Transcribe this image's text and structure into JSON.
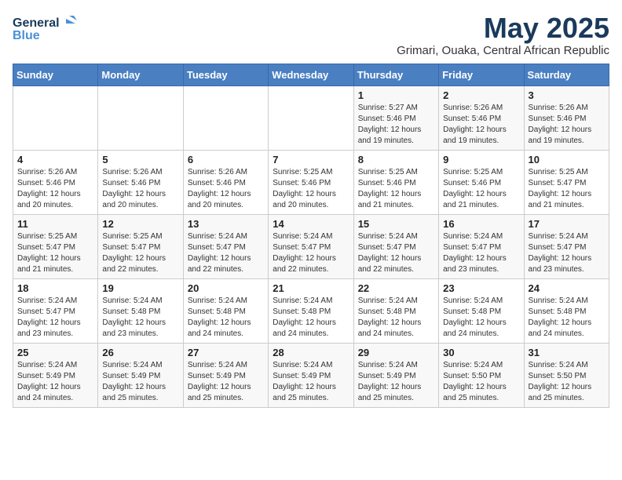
{
  "logo": {
    "line1": "General",
    "line2": "Blue"
  },
  "title": {
    "month": "May 2025",
    "location": "Grimari, Ouaka, Central African Republic"
  },
  "weekdays": [
    "Sunday",
    "Monday",
    "Tuesday",
    "Wednesday",
    "Thursday",
    "Friday",
    "Saturday"
  ],
  "weeks": [
    [
      {
        "day": "",
        "info": ""
      },
      {
        "day": "",
        "info": ""
      },
      {
        "day": "",
        "info": ""
      },
      {
        "day": "",
        "info": ""
      },
      {
        "day": "1",
        "info": "Sunrise: 5:27 AM\nSunset: 5:46 PM\nDaylight: 12 hours\nand 19 minutes."
      },
      {
        "day": "2",
        "info": "Sunrise: 5:26 AM\nSunset: 5:46 PM\nDaylight: 12 hours\nand 19 minutes."
      },
      {
        "day": "3",
        "info": "Sunrise: 5:26 AM\nSunset: 5:46 PM\nDaylight: 12 hours\nand 19 minutes."
      }
    ],
    [
      {
        "day": "4",
        "info": "Sunrise: 5:26 AM\nSunset: 5:46 PM\nDaylight: 12 hours\nand 20 minutes."
      },
      {
        "day": "5",
        "info": "Sunrise: 5:26 AM\nSunset: 5:46 PM\nDaylight: 12 hours\nand 20 minutes."
      },
      {
        "day": "6",
        "info": "Sunrise: 5:26 AM\nSunset: 5:46 PM\nDaylight: 12 hours\nand 20 minutes."
      },
      {
        "day": "7",
        "info": "Sunrise: 5:25 AM\nSunset: 5:46 PM\nDaylight: 12 hours\nand 20 minutes."
      },
      {
        "day": "8",
        "info": "Sunrise: 5:25 AM\nSunset: 5:46 PM\nDaylight: 12 hours\nand 21 minutes."
      },
      {
        "day": "9",
        "info": "Sunrise: 5:25 AM\nSunset: 5:46 PM\nDaylight: 12 hours\nand 21 minutes."
      },
      {
        "day": "10",
        "info": "Sunrise: 5:25 AM\nSunset: 5:47 PM\nDaylight: 12 hours\nand 21 minutes."
      }
    ],
    [
      {
        "day": "11",
        "info": "Sunrise: 5:25 AM\nSunset: 5:47 PM\nDaylight: 12 hours\nand 21 minutes."
      },
      {
        "day": "12",
        "info": "Sunrise: 5:25 AM\nSunset: 5:47 PM\nDaylight: 12 hours\nand 22 minutes."
      },
      {
        "day": "13",
        "info": "Sunrise: 5:24 AM\nSunset: 5:47 PM\nDaylight: 12 hours\nand 22 minutes."
      },
      {
        "day": "14",
        "info": "Sunrise: 5:24 AM\nSunset: 5:47 PM\nDaylight: 12 hours\nand 22 minutes."
      },
      {
        "day": "15",
        "info": "Sunrise: 5:24 AM\nSunset: 5:47 PM\nDaylight: 12 hours\nand 22 minutes."
      },
      {
        "day": "16",
        "info": "Sunrise: 5:24 AM\nSunset: 5:47 PM\nDaylight: 12 hours\nand 23 minutes."
      },
      {
        "day": "17",
        "info": "Sunrise: 5:24 AM\nSunset: 5:47 PM\nDaylight: 12 hours\nand 23 minutes."
      }
    ],
    [
      {
        "day": "18",
        "info": "Sunrise: 5:24 AM\nSunset: 5:47 PM\nDaylight: 12 hours\nand 23 minutes."
      },
      {
        "day": "19",
        "info": "Sunrise: 5:24 AM\nSunset: 5:48 PM\nDaylight: 12 hours\nand 23 minutes."
      },
      {
        "day": "20",
        "info": "Sunrise: 5:24 AM\nSunset: 5:48 PM\nDaylight: 12 hours\nand 24 minutes."
      },
      {
        "day": "21",
        "info": "Sunrise: 5:24 AM\nSunset: 5:48 PM\nDaylight: 12 hours\nand 24 minutes."
      },
      {
        "day": "22",
        "info": "Sunrise: 5:24 AM\nSunset: 5:48 PM\nDaylight: 12 hours\nand 24 minutes."
      },
      {
        "day": "23",
        "info": "Sunrise: 5:24 AM\nSunset: 5:48 PM\nDaylight: 12 hours\nand 24 minutes."
      },
      {
        "day": "24",
        "info": "Sunrise: 5:24 AM\nSunset: 5:48 PM\nDaylight: 12 hours\nand 24 minutes."
      }
    ],
    [
      {
        "day": "25",
        "info": "Sunrise: 5:24 AM\nSunset: 5:49 PM\nDaylight: 12 hours\nand 24 minutes."
      },
      {
        "day": "26",
        "info": "Sunrise: 5:24 AM\nSunset: 5:49 PM\nDaylight: 12 hours\nand 25 minutes."
      },
      {
        "day": "27",
        "info": "Sunrise: 5:24 AM\nSunset: 5:49 PM\nDaylight: 12 hours\nand 25 minutes."
      },
      {
        "day": "28",
        "info": "Sunrise: 5:24 AM\nSunset: 5:49 PM\nDaylight: 12 hours\nand 25 minutes."
      },
      {
        "day": "29",
        "info": "Sunrise: 5:24 AM\nSunset: 5:49 PM\nDaylight: 12 hours\nand 25 minutes."
      },
      {
        "day": "30",
        "info": "Sunrise: 5:24 AM\nSunset: 5:50 PM\nDaylight: 12 hours\nand 25 minutes."
      },
      {
        "day": "31",
        "info": "Sunrise: 5:24 AM\nSunset: 5:50 PM\nDaylight: 12 hours\nand 25 minutes."
      }
    ]
  ]
}
